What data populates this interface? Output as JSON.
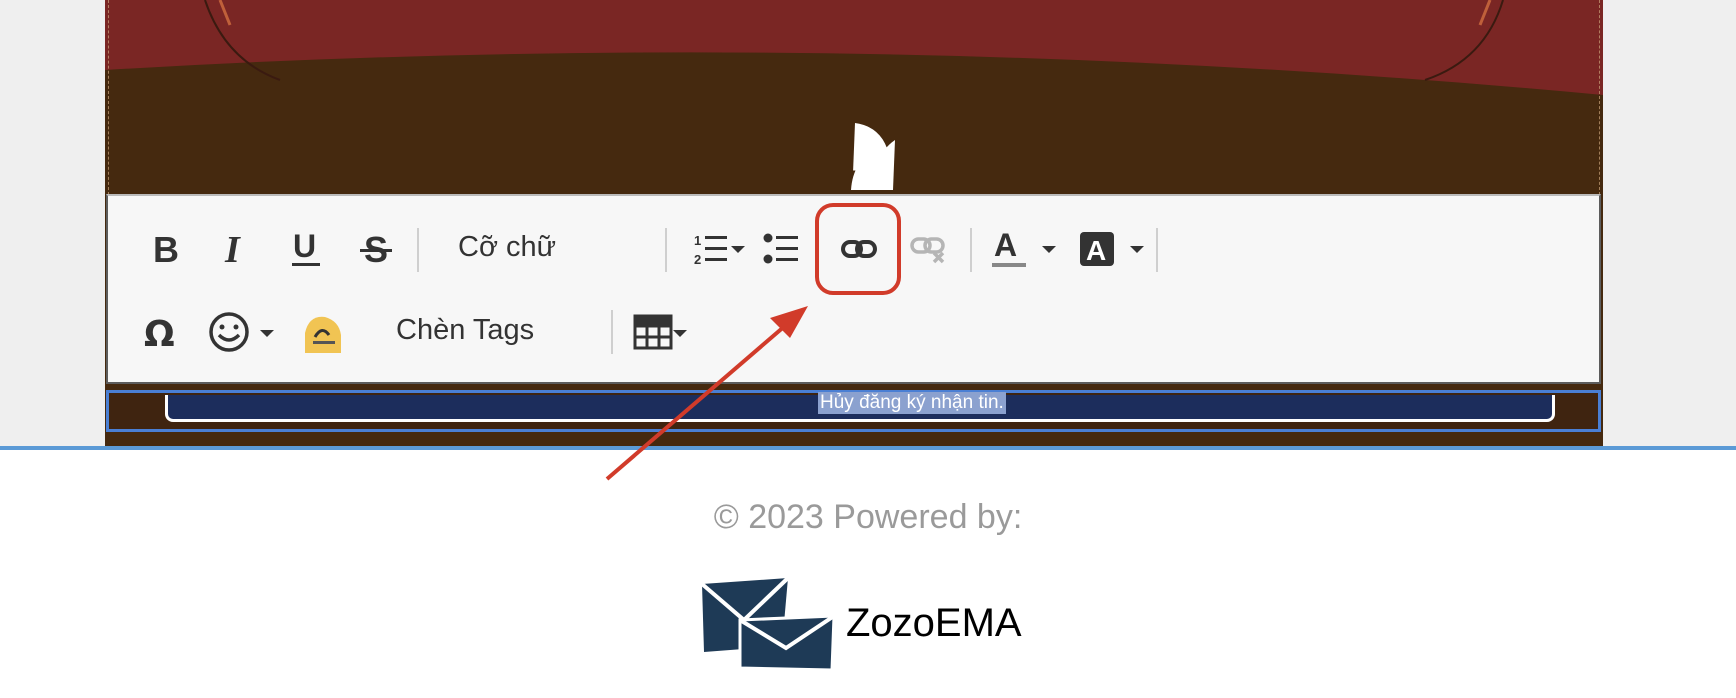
{
  "toolbar": {
    "row1": {
      "bold_icon": "bold-icon",
      "italic_icon": "italic-icon",
      "underline_icon": "underline-icon",
      "strike_icon": "strikethrough-icon",
      "font_size_label": "Cỡ chữ",
      "ordered_list_icon": "ordered-list-icon",
      "bullet_list_icon": "bullet-list-icon",
      "link_icon": "link-icon",
      "unlink_icon": "unlink-icon",
      "text_color_icon": "text-color-icon",
      "bg_color_icon": "background-color-icon"
    },
    "row2": {
      "special_char_icon": "omega-icon",
      "emoji_icon": "emoji-icon",
      "image_icon": "image-icon",
      "insert_tags_label": "Chèn Tags",
      "table_icon": "table-icon"
    }
  },
  "email": {
    "selected_text": "Hủy đăng ký nhận tin."
  },
  "footer": {
    "powered_by": "© 2023 Powered by:",
    "brand_name": "ZozoEMA",
    "brand_logo_icon": "envelope-logo-icon"
  },
  "annotation": {
    "highlight_color": "#d13b2a",
    "arrow_color": "#d13b2a"
  },
  "colors": {
    "canvas_red": "#7a2624",
    "canvas_brown": "#45290f",
    "selection_blue": "#5b9ad6"
  }
}
